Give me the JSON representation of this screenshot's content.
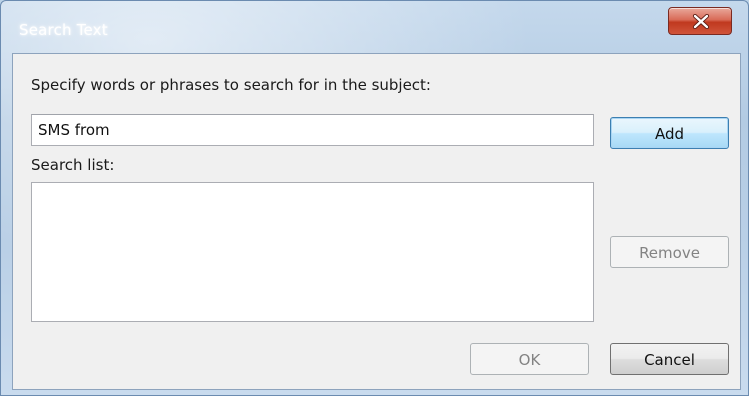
{
  "window": {
    "title": "Search Text"
  },
  "dialog": {
    "prompt_label": "Specify words or phrases to search for in the subject:",
    "search_input": {
      "value": "SMS from",
      "placeholder": ""
    },
    "search_list_label": "Search list:",
    "search_list_items": [],
    "buttons": {
      "add": "Add",
      "remove": "Remove",
      "ok": "OK",
      "cancel": "Cancel"
    }
  },
  "icons": {
    "close": "close-icon"
  },
  "colors": {
    "close_button": "#c0391f",
    "client_background": "#f0f0f0",
    "default_button_border": "#3c7fb1",
    "disabled_text": "#838383"
  }
}
